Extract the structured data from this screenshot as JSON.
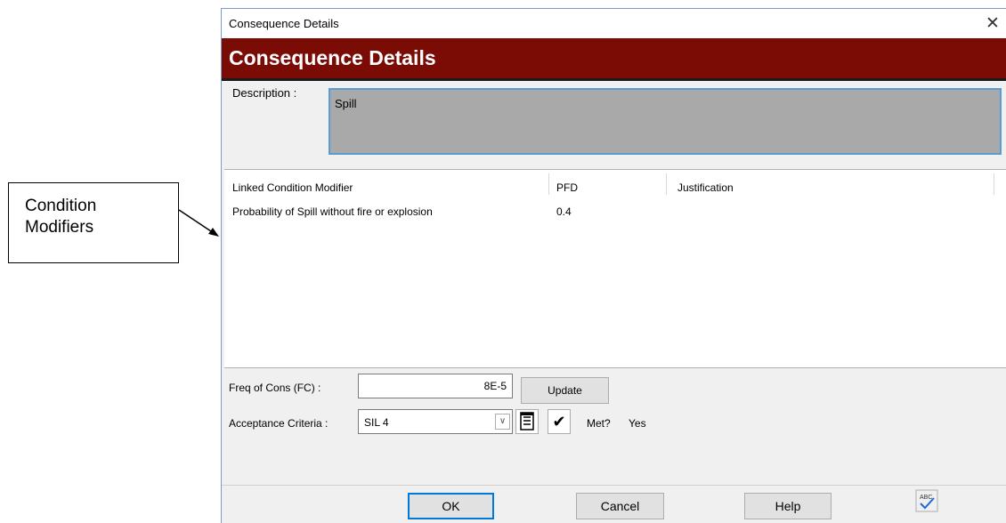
{
  "callout": {
    "text": "Condition\nModifiers"
  },
  "dialog": {
    "title": "Consequence Details",
    "header": "Consequence Details",
    "description": {
      "label": "Description :",
      "value": "Spill"
    },
    "grid": {
      "columns": [
        "Linked Condition Modifier",
        "PFD",
        "Justification"
      ],
      "rows": [
        {
          "modifier": "Probability of Spill without fire or explosion",
          "pfd": "0.4",
          "justification": ""
        }
      ]
    },
    "freq": {
      "label": "Freq of Cons (FC) :",
      "value": "8E-5",
      "update_label": "Update"
    },
    "acceptance": {
      "label": "Acceptance Criteria :",
      "value": "SIL 4",
      "met_label": "Met?",
      "met_value": "Yes"
    },
    "buttons": {
      "ok": "OK",
      "cancel": "Cancel",
      "help": "Help"
    },
    "icons": {
      "close": "close-icon",
      "dropdown": "chevron-down-icon",
      "list": "list-icon",
      "check": "checkmark-icon",
      "spell": "spellcheck-icon"
    },
    "colors": {
      "header_band": "#7a0b05",
      "description_bg": "#a9a9a9",
      "focus_border": "#0078d7"
    }
  }
}
